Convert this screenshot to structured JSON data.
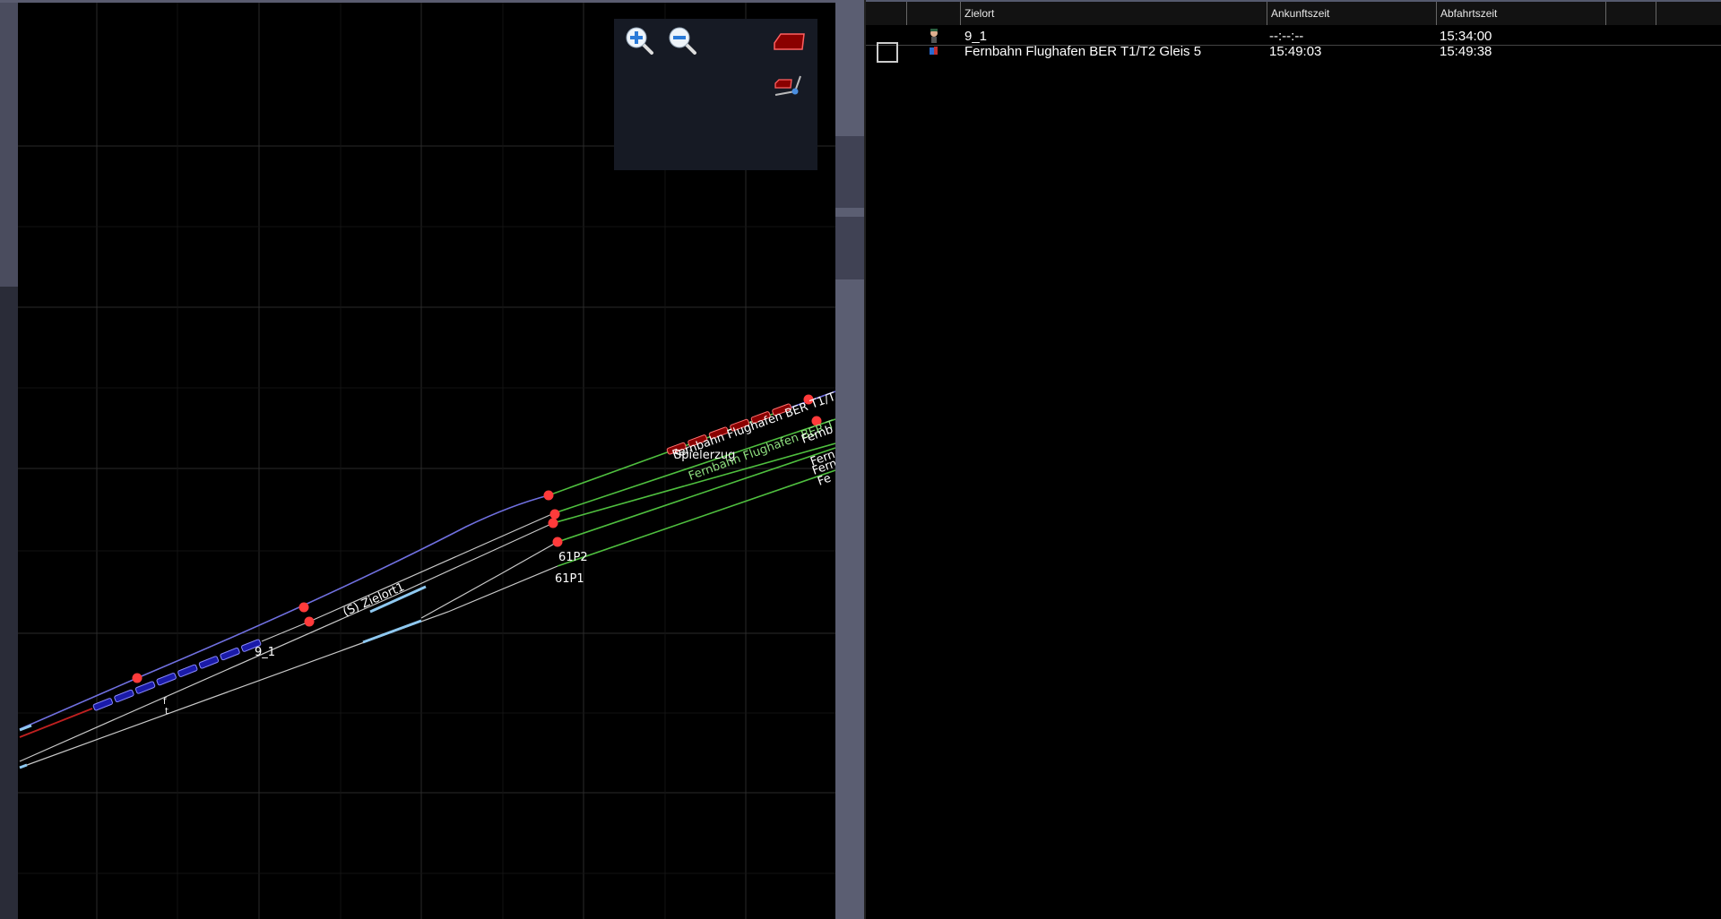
{
  "map": {
    "train_labels": {
      "player_train": "9_1",
      "other_train": "Spielerzug"
    },
    "track_labels": {
      "zielort": "(S) Zielort1",
      "p2": "61P2",
      "p1": "61P1",
      "signal_marks": [
        "f",
        "t"
      ],
      "destination_white": "Fernbahn Flughafen BER T1/T",
      "destination_green": "Fernbahn Flughafen BER T",
      "edge_clipped": [
        "Fernb",
        "Fern",
        "Fern",
        "Fe"
      ]
    },
    "toolbar": {
      "zoom_in_icon": "zoom-in-icon",
      "zoom_out_icon": "zoom-out-icon",
      "signal_icon": "red-signal-shape-icon",
      "switch_icon": "switch-signal-icon"
    },
    "colors": {
      "track": "#c8c8c8",
      "route": "#7070e0",
      "platform": "#4fbf3f",
      "signal": "#ff3b3b",
      "player_train": "#1a1aa8",
      "other_train": "#8a0000"
    }
  },
  "timetable": {
    "columns": [
      "",
      "",
      "Zielort",
      "Ankunftszeit",
      "Abfahrtszeit",
      "",
      ""
    ],
    "rows": [
      {
        "zielort": "9_1",
        "ankunft": "--:--:--",
        "abfahrt": "15:34:00"
      },
      {
        "zielort": "Fernbahn Flughafen BER T1/T2 Gleis 5",
        "ankunft": "15:49:03",
        "abfahrt": "15:49:38"
      }
    ]
  }
}
